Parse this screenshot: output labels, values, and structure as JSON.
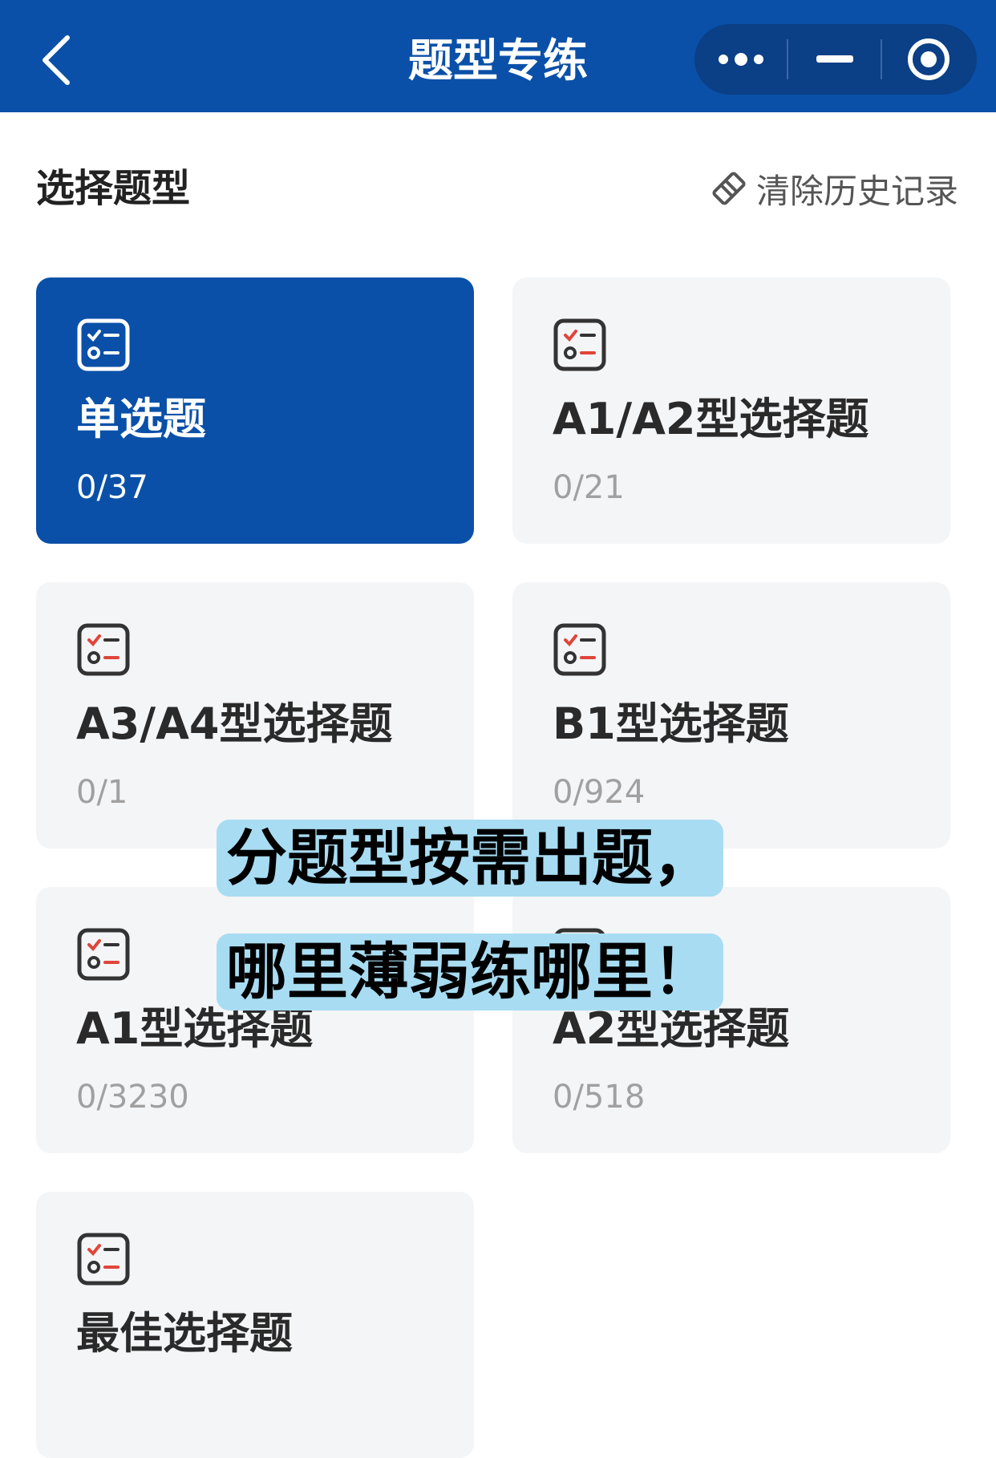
{
  "header": {
    "title": "题型专练",
    "back_icon": "chevron-left-icon",
    "capsule": [
      "more-dots-icon",
      "minimize-icon",
      "close-target-icon"
    ],
    "background": "#0a50a8"
  },
  "section": {
    "title": "选择题型",
    "clear_history_label": "清除历史记录",
    "clear_history_icon": "eraser-icon"
  },
  "cards": [
    {
      "label": "单选题",
      "count": "0/37",
      "selected": true,
      "icon": "checklist-icon"
    },
    {
      "label": "A1/A2型选择题",
      "count": "0/21",
      "selected": false,
      "icon": "checklist-icon"
    },
    {
      "label": "A3/A4型选择题",
      "count": "0/1",
      "selected": false,
      "icon": "checklist-icon"
    },
    {
      "label": "B1型选择题",
      "count": "0/924",
      "selected": false,
      "icon": "checklist-icon"
    },
    {
      "label": "A1型选择题",
      "count": "0/3230",
      "selected": false,
      "icon": "checklist-icon"
    },
    {
      "label": "A2型选择题",
      "count": "0/518",
      "selected": false,
      "icon": "checklist-icon"
    },
    {
      "label": "最佳选择题",
      "count": "",
      "selected": false,
      "icon": "checklist-icon"
    }
  ],
  "overlay": {
    "line1": "分题型按需出题，",
    "line2": "哪里薄弱练哪里！",
    "highlight_color": "#a8dcf2"
  },
  "colors": {
    "primary": "#0a50a8",
    "card_bg": "#f4f5f7",
    "icon_accent": "#e0453a"
  }
}
